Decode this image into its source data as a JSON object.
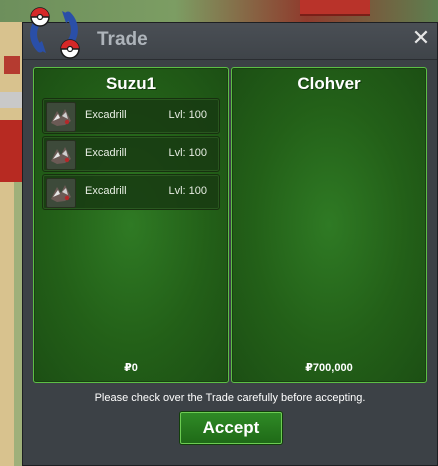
{
  "window": {
    "title": "Trade",
    "close_label": "✕"
  },
  "left_panel": {
    "player": "Suzu1",
    "items": [
      {
        "name": "Excadrill",
        "level": "Lvl: 100",
        "icon": "excadrill-icon"
      },
      {
        "name": "Excadrill",
        "level": "Lvl: 100",
        "icon": "excadrill-icon"
      },
      {
        "name": "Excadrill",
        "level": "Lvl: 100",
        "icon": "excadrill-icon"
      }
    ],
    "money": "₽0"
  },
  "right_panel": {
    "player": "Clohver",
    "money": "₽700,000"
  },
  "footer": {
    "notice": "Please check over the Trade carefully before accepting.",
    "accept_label": "Accept"
  },
  "colors": {
    "panel_green": "#236018",
    "panel_border": "#5cbf45",
    "window_bg": "#3c4146",
    "title_text": "#aeb4ba"
  }
}
